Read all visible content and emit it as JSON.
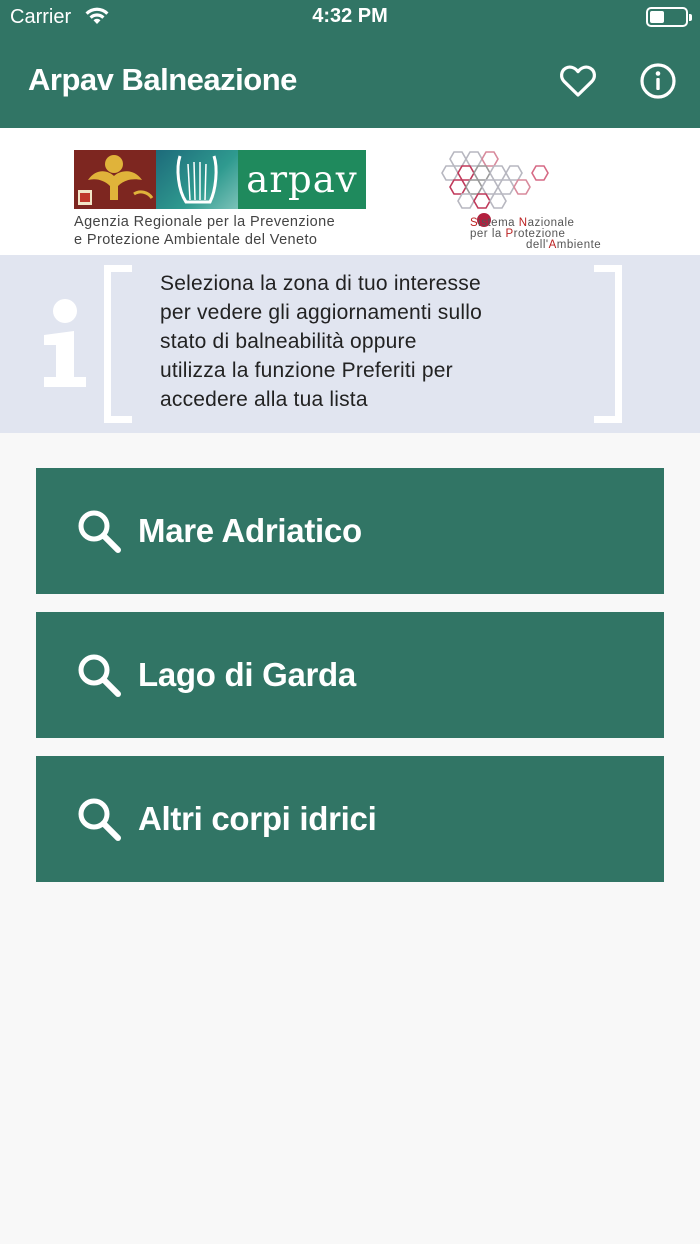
{
  "status_bar": {
    "carrier": "Carrier",
    "time": "4:32 PM",
    "battery_level": 0.4
  },
  "nav": {
    "title": "Arpav Balneazione",
    "favorites_icon": "heart-icon",
    "info_icon": "info-icon"
  },
  "logos": {
    "arpav": {
      "wordmark": "arpav",
      "line1": "Agenzia Regionale per la Prevenzione",
      "line2": "e Protezione Ambientale del Veneto"
    },
    "snpa": {
      "line1_prefix": "S",
      "line1_a": "istema ",
      "line1_b": "N",
      "line1_c": "azionale",
      "line2_a": "per la ",
      "line2_b": "P",
      "line2_c": "rotezione",
      "line3_a": "dell'",
      "line3_b": "A",
      "line3_c": "mbiente"
    }
  },
  "info": {
    "line1": "Seleziona la zona di tuo interesse",
    "line2": "per vedere gli aggiornamenti sullo",
    "line3": "stato di balneabilità oppure",
    "line4": "utilizza la funzione Preferiti per",
    "line5": "accedere alla tua lista"
  },
  "menu": [
    {
      "label": "Mare Adriatico",
      "icon": "search-icon"
    },
    {
      "label": "Lago di Garda",
      "icon": "search-icon"
    },
    {
      "label": "Altri corpi idrici",
      "icon": "search-icon"
    }
  ],
  "colors": {
    "primary": "#317565",
    "info_bg": "#e1e5f0",
    "background": "#f8f8f8"
  }
}
